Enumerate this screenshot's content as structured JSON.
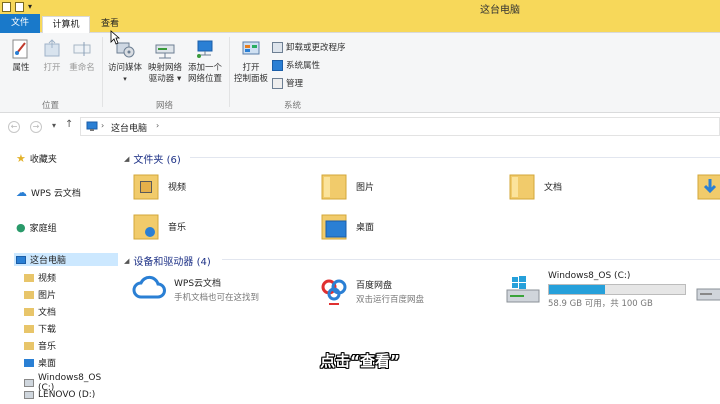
{
  "window": {
    "title": "这台电脑"
  },
  "tabs": {
    "file": "文件",
    "computer": "计算机",
    "view": "查看"
  },
  "ribbon": {
    "location": {
      "label": "位置",
      "properties": "属性",
      "open": "打开",
      "rename": "重命名"
    },
    "network": {
      "label": "网络",
      "access_media": "访问媒体",
      "map_drive_1": "映射网络",
      "map_drive_2": "驱动器",
      "add_location_1": "添加一个",
      "add_location_2": "网络位置"
    },
    "system": {
      "label": "系统",
      "open_cp_1": "打开",
      "open_cp_2": "控制面板",
      "uninstall": "卸载或更改程序",
      "sys_props": "系统属性",
      "manage": "管理"
    }
  },
  "address": {
    "path": "这台电脑"
  },
  "sidebar": {
    "favorites": "收藏夹",
    "wps": "WPS 云文档",
    "homegroup": "家庭组",
    "this_pc": "这台电脑",
    "children": [
      "视频",
      "图片",
      "文档",
      "下载",
      "音乐",
      "桌面",
      "Windows8_OS (C:)",
      "LENOVO (D:)"
    ]
  },
  "folders": {
    "header": "文件夹 (6)",
    "items": [
      "视频",
      "图片",
      "文档",
      "音乐",
      "桌面"
    ]
  },
  "devices": {
    "header": "设备和驱动器 (4)",
    "wps_name": "WPS云文档",
    "wps_desc": "手机文档也可在这找到",
    "baidu_name": "百度网盘",
    "baidu_desc": "双击运行百度网盘",
    "c_name": "Windows8_OS (C:)",
    "c_free": "58.9 GB 可用，共 100 GB",
    "c_used_fraction": 0.41
  },
  "subtitle": "点击“查看”",
  "colors": {
    "accent": "#1979ca",
    "title_bar": "#f7d85a",
    "header_text": "#1e3287",
    "drive_fill": "#26a0da"
  }
}
